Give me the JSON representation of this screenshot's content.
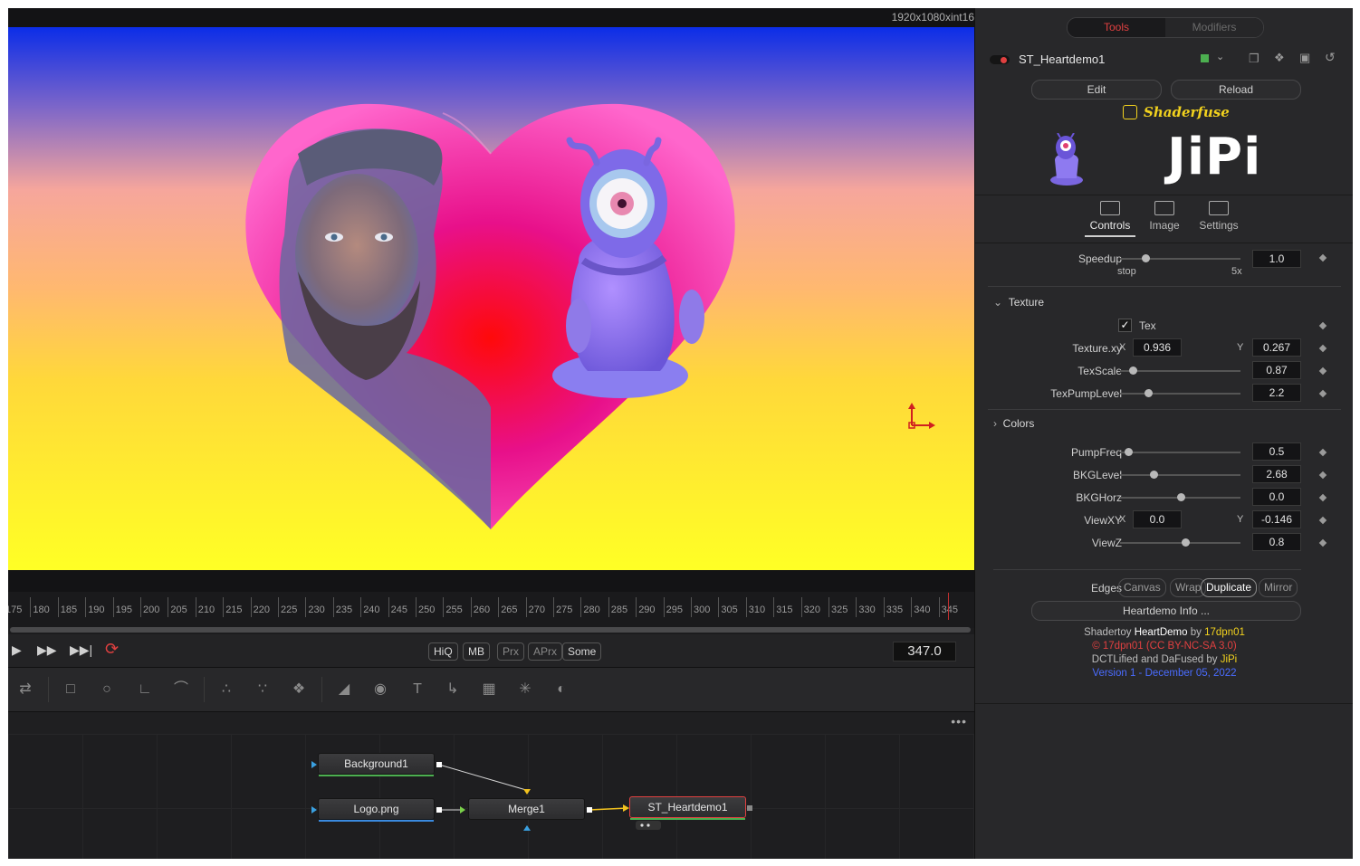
{
  "viewer": {
    "resolution": "1920x1080xint16"
  },
  "timeline": {
    "ticks": [
      "175",
      "180",
      "185",
      "190",
      "195",
      "200",
      "205",
      "210",
      "215",
      "220",
      "225",
      "230",
      "235",
      "240",
      "245",
      "250",
      "255",
      "260",
      "265",
      "270",
      "275",
      "280",
      "285",
      "290",
      "295",
      "300",
      "305",
      "310",
      "315",
      "320",
      "325",
      "330",
      "335",
      "340",
      "345"
    ],
    "current_frame": "347.0"
  },
  "transport": {
    "play_icon": "play-icon",
    "step_icon": "fast-forward-icon",
    "end_icon": "skip-to-end-icon",
    "loop_icon": "loop-icon",
    "toggles": [
      "HiQ",
      "MB",
      "Prx",
      "APrx",
      "Some"
    ]
  },
  "nodes": {
    "background": "Background1",
    "logo": "Logo.png",
    "merge": "Merge1",
    "shader": "ST_Heartdemo1"
  },
  "inspector": {
    "tab_tools": "Tools",
    "tab_modifiers": "Modifiers",
    "node_name": "ST_Heartdemo1",
    "edit_button": "Edit",
    "reload_button": "Reload",
    "brand_name": "Shaderfuse",
    "brand_logo": "JiPi",
    "tabs": [
      "Controls",
      "Image",
      "Settings"
    ],
    "controls": {
      "speedup_label": "Speedup",
      "speedup_min": "stop",
      "speedup_max": "5x",
      "speedup_value": "1.0",
      "speedup_fraction": 0.2,
      "texture_section": "Texture",
      "tex_label": "Tex",
      "texture_xy_label": "Texture.xy",
      "x_label": "X",
      "y_label": "Y",
      "texture_x": "0.936",
      "texture_y": "0.267",
      "texscale_label": "TexScale",
      "texscale_value": "0.87",
      "texpump_label": "TexPumpLevel",
      "texpump_value": "2.2",
      "colors_section": "Colors",
      "pumpfreq_label": "PumpFreq",
      "pumpfreq_value": "0.5",
      "bkglevel_label": "BKGLevel",
      "bkglevel_value": "2.68",
      "bkghorz_label": "BKGHorz",
      "bkghorz_value": "0.0",
      "viewxy_label": "ViewXY",
      "viewxy_x": "0.0",
      "viewxy_y": "-0.146",
      "viewz_label": "ViewZ",
      "viewz_value": "0.8",
      "edges_label": "Edges",
      "edges_options": [
        "Canvas",
        "Wrap",
        "Duplicate",
        "Mirror"
      ],
      "edges_selected": "Duplicate",
      "info_button": "Heartdemo Info ..."
    },
    "credits": {
      "line1_prefix": "Shadertoy",
      "line1_name": "HeartDemo",
      "line1_by": "by",
      "line1_author": "17dpn01",
      "line2": "© 17dpn01 (CC BY-NC-SA 3.0)",
      "line3_prefix": "DCTLified and DaFused by",
      "line3_author": "JiPi",
      "line4": "Version 1 - December 05, 2022"
    }
  },
  "colors": {
    "accent_red": "#e04040",
    "node_green": "#4caf50",
    "yellow": "#f2d21e",
    "blue_link": "#4a6cff"
  }
}
